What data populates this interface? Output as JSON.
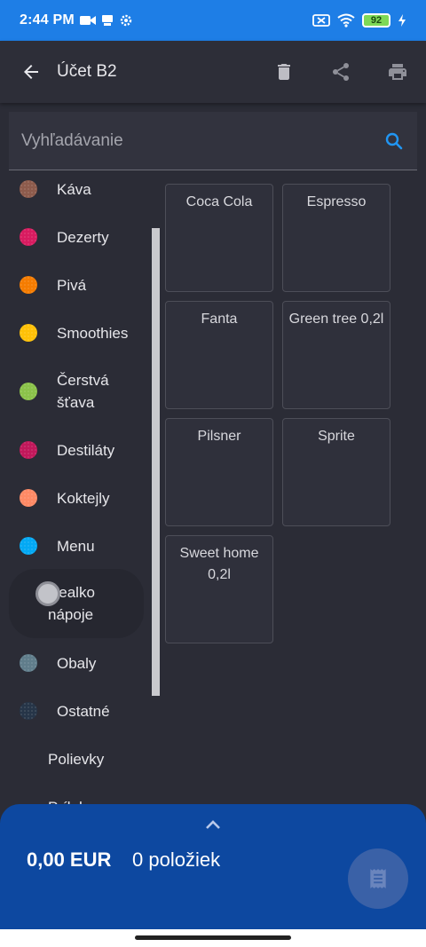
{
  "status_bar": {
    "time": "2:44 PM",
    "battery": "92"
  },
  "app_bar": {
    "title": "Účet B2"
  },
  "search": {
    "placeholder": "Vyhľadávanie"
  },
  "categories": [
    {
      "label": "Káva",
      "color": "#8d5b4c"
    },
    {
      "label": "Dezerty",
      "color": "#d81b60"
    },
    {
      "label": "Pivá",
      "color": "#f57c00"
    },
    {
      "label": "Smoothies",
      "color": "#ffc107"
    },
    {
      "label": "Čerstvá\nšťava",
      "color": "#8bc34a"
    },
    {
      "label": "Destiláty",
      "color": "#c2185b"
    },
    {
      "label": "Koktejly",
      "color": "#ff8a65"
    },
    {
      "label": "Menu",
      "color": "#03a9f4"
    },
    {
      "label": "Nealko\nnápoje",
      "color": ""
    },
    {
      "label": "Obaly",
      "color": "#607d8b"
    },
    {
      "label": "Ostatné",
      "color": "#263548"
    },
    {
      "label": "Polievky",
      "color": ""
    },
    {
      "label": "Prílohy",
      "color": ""
    }
  ],
  "products": [
    "Coca Cola",
    "Espresso",
    "Fanta",
    "Green tree 0,2l",
    "Pilsner",
    "Sprite",
    "Sweet home\n0,2l"
  ],
  "summary": {
    "total": "0,00 EUR",
    "count": "0 položiek"
  }
}
